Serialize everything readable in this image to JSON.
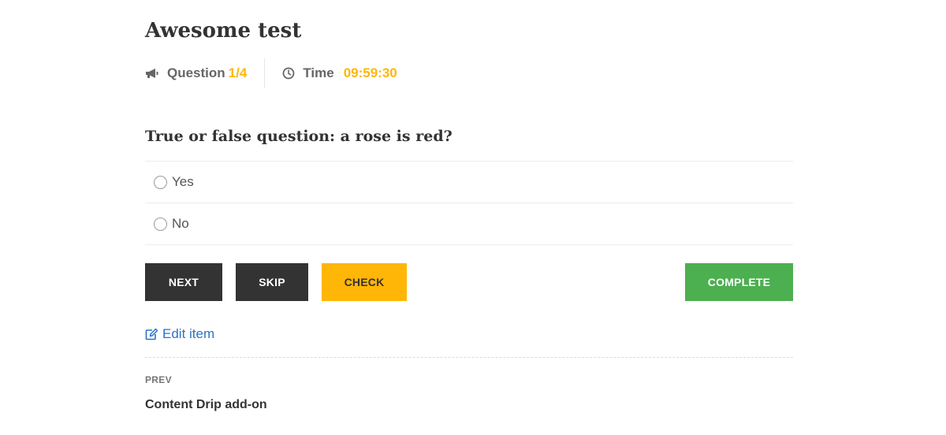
{
  "quiz": {
    "title": "Awesome test",
    "question_label": "Question",
    "question_progress": "1/4",
    "time_label": "Time",
    "time_value": "09:59:30"
  },
  "question": {
    "text": "True or false question: a rose is red?",
    "answers": [
      {
        "label": "Yes",
        "selected": false
      },
      {
        "label": "No",
        "selected": false
      }
    ]
  },
  "buttons": {
    "next": "NEXT",
    "skip": "SKIP",
    "check": "CHECK",
    "complete": "COMPLETE"
  },
  "edit_link": "Edit item",
  "navigation": {
    "prev_label": "PREV",
    "prev_title": "Content Drip add-on"
  },
  "icons": {
    "question": "megaphone-icon",
    "time": "clock-icon",
    "edit": "edit-icon"
  },
  "colors": {
    "accent": "#ffb606",
    "dark_button": "#333333",
    "complete_button": "#4caf50",
    "link": "#2a73c6"
  }
}
